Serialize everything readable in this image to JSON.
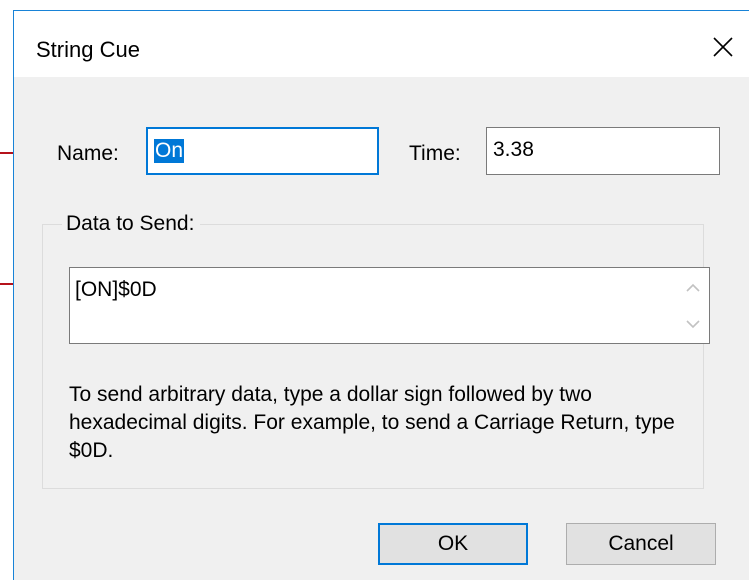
{
  "dialog": {
    "title": "String Cue"
  },
  "form": {
    "name_label": "Name:",
    "name_value": "On",
    "time_label": "Time:",
    "time_value": "3.38"
  },
  "data_group": {
    "legend": "Data to Send:",
    "data_value": "[ON]$0D",
    "help_text": "To send arbitrary data, type a dollar sign followed by two hexadecimal digits. For example, to send a Carriage Return, type $0D."
  },
  "buttons": {
    "ok_label": "OK",
    "cancel_label": "Cancel"
  },
  "colors": {
    "accent": "#0078d7",
    "window_border": "#1883d7",
    "callout": "#b5121b",
    "dialog_bg": "#f0f0f0"
  },
  "icons": {
    "close": "close-icon",
    "scroll_up": "chevron-up-icon",
    "scroll_down": "chevron-down-icon"
  }
}
